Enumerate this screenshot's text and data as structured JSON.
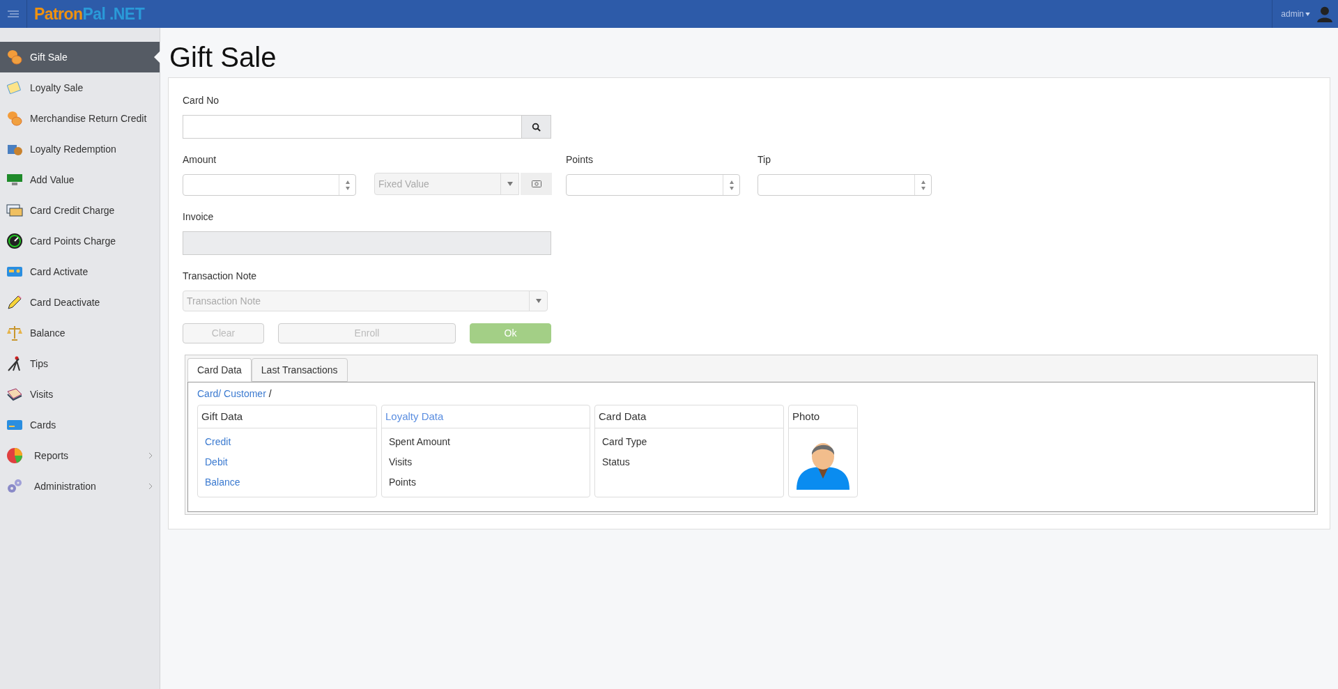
{
  "header": {
    "logo": {
      "first": "Patron",
      "second": "Pal .NET"
    },
    "user": "admin"
  },
  "sidebar": {
    "items": [
      {
        "label": "Gift Sale",
        "selected": true,
        "expandable": false
      },
      {
        "label": "Loyalty Sale",
        "selected": false,
        "expandable": false
      },
      {
        "label": "Merchandise Return Credit",
        "selected": false,
        "expandable": false
      },
      {
        "label": "Loyalty Redemption",
        "selected": false,
        "expandable": false
      },
      {
        "label": "Add Value",
        "selected": false,
        "expandable": false
      },
      {
        "label": "Card Credit Charge",
        "selected": false,
        "expandable": false
      },
      {
        "label": "Card Points Charge",
        "selected": false,
        "expandable": false
      },
      {
        "label": "Card Activate",
        "selected": false,
        "expandable": false
      },
      {
        "label": "Card Deactivate",
        "selected": false,
        "expandable": false
      },
      {
        "label": "Balance",
        "selected": false,
        "expandable": false
      },
      {
        "label": "Tips",
        "selected": false,
        "expandable": false
      },
      {
        "label": "Visits",
        "selected": false,
        "expandable": false
      },
      {
        "label": "Cards",
        "selected": false,
        "expandable": false
      },
      {
        "label": "Reports",
        "selected": false,
        "expandable": true
      },
      {
        "label": "Administration",
        "selected": false,
        "expandable": true
      }
    ]
  },
  "page": {
    "title": "Gift Sale"
  },
  "form": {
    "card_no": {
      "label": "Card No"
    },
    "amount": {
      "label": "Amount"
    },
    "value_type": {
      "value": "Fixed Value"
    },
    "points": {
      "label": "Points"
    },
    "tip": {
      "label": "Tip"
    },
    "invoice": {
      "label": "Invoice",
      "disabled": true
    },
    "transaction_note": {
      "label": "Transaction Note",
      "placeholder": "Transaction Note"
    },
    "buttons": [
      {
        "label": "Clear",
        "kind": "default",
        "disabled": true
      },
      {
        "label": "Enroll",
        "kind": "default",
        "disabled": true
      },
      {
        "label": "Ok",
        "kind": "primary",
        "disabled": true
      }
    ]
  },
  "tabs": [
    {
      "label": "Card Data",
      "selected": true
    },
    {
      "label": "Last Transactions",
      "selected": false
    }
  ],
  "breadcrumb": {
    "link": "Card/ Customer",
    "separator": "/"
  },
  "panels": [
    {
      "kind": "list",
      "title": "Gift Data",
      "title_link": false,
      "items_link": true,
      "items": [
        "Credit",
        "Debit",
        "Balance"
      ]
    },
    {
      "kind": "list",
      "title": "Loyalty Data",
      "title_link": true,
      "items_link": false,
      "items": [
        "Spent Amount",
        "Visits",
        "Points"
      ]
    },
    {
      "kind": "list",
      "title": "Card Data",
      "title_link": false,
      "items_link": false,
      "items": [
        "Card Type",
        "Status"
      ]
    },
    {
      "kind": "photo",
      "title": "Photo",
      "title_link": false
    }
  ]
}
